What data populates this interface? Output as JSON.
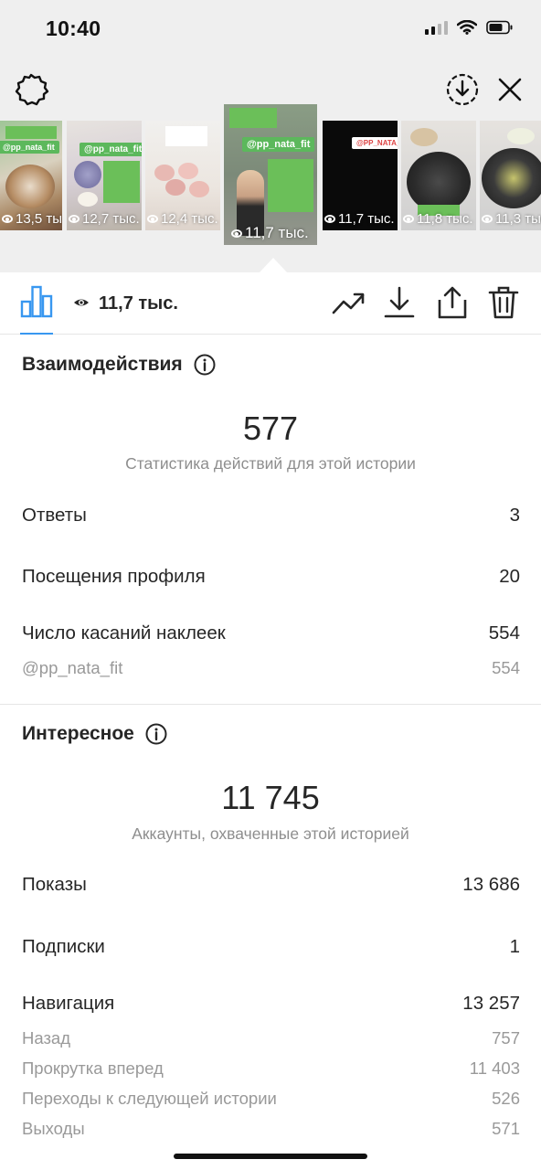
{
  "status_bar": {
    "time": "10:40"
  },
  "stories": [
    {
      "views": "13,5 тыс.",
      "tag": "@pp_nata_fit"
    },
    {
      "views": "12,7 тыс.",
      "tag": "@pp_nata_fit"
    },
    {
      "views": "12,4 тыс.",
      "tag": ""
    },
    {
      "views": "11,7 тыс.",
      "tag": "@pp_nata_fit",
      "active": true
    },
    {
      "views": "11,7 тыс.",
      "tag": "@PP_NATA_FIT"
    },
    {
      "views": "11,8 тыс.",
      "tag": ""
    },
    {
      "views": "11,3 тыс.",
      "tag": ""
    }
  ],
  "toolbar": {
    "views": "11,7 тыс."
  },
  "interactions": {
    "title": "Взаимодействия",
    "total": "577",
    "caption": "Статистика действий для этой истории",
    "rows": [
      {
        "label": "Ответы",
        "value": "3"
      },
      {
        "label": "Посещения профиля",
        "value": "20"
      },
      {
        "label": "Число касаний наклеек",
        "value": "554"
      }
    ],
    "sub_rows": [
      {
        "label": "@pp_nata_fit",
        "value": "554"
      }
    ]
  },
  "discovery": {
    "title": "Интересное",
    "total": "11 745",
    "caption": "Аккаунты, охваченные этой историей",
    "rows": [
      {
        "label": "Показы",
        "value": "13 686"
      },
      {
        "label": "Подписки",
        "value": "1"
      },
      {
        "label": "Навигация",
        "value": "13 257"
      }
    ],
    "navigation": [
      {
        "label": "Назад",
        "value": "757"
      },
      {
        "label": "Прокрутка вперед",
        "value": "11 403"
      },
      {
        "label": "Переходы к следующей истории",
        "value": "526"
      },
      {
        "label": "Выходы",
        "value": "571"
      }
    ]
  },
  "colors": {
    "accent": "#3897f0",
    "muted": "#8e8e8e",
    "green_tag": "#5cb85c"
  },
  "icons": [
    "settings-icon",
    "download-circle-icon",
    "close-icon",
    "bar-chart-icon",
    "eye-icon",
    "trend-icon",
    "download-icon",
    "share-icon",
    "trash-icon",
    "info-icon"
  ]
}
